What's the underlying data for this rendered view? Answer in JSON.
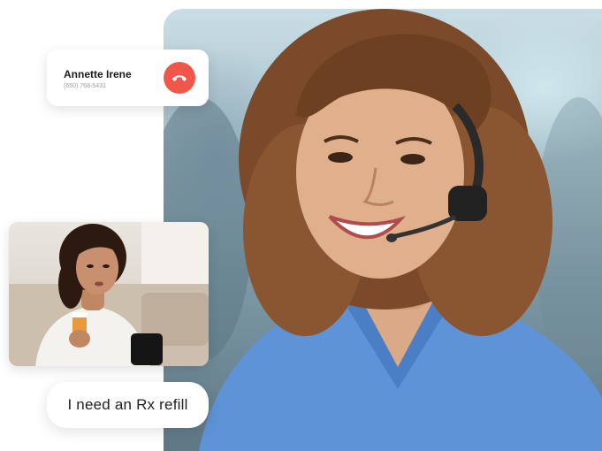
{
  "call": {
    "caller_name": "Annette Irene",
    "caller_phone": "(650) 768-5431",
    "hangup_icon": "phone-hangup-icon",
    "hangup_color": "#f0564a"
  },
  "video": {
    "description_icon": "patient-video-thumbnail"
  },
  "message": {
    "text": "I need an Rx refill"
  },
  "colors": {
    "scrubs": "#5e93d8",
    "card_background": "#ffffff"
  }
}
